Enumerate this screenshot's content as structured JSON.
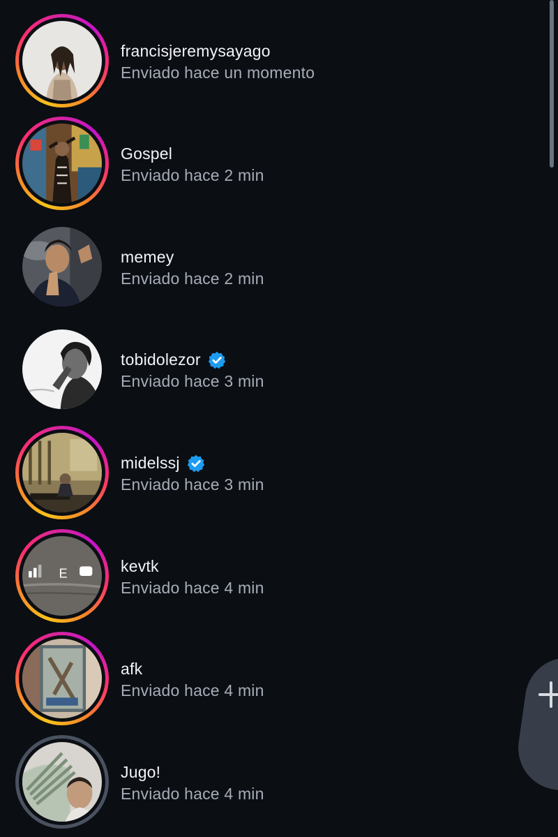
{
  "colors": {
    "background": "#0b0e13",
    "name_text": "#f2f4f7",
    "subtitle_text": "#a6adb8",
    "verified_badge": "#1d9bf0",
    "story_ring": "gradient",
    "seen_ring": "#4a5260"
  },
  "rows": [
    {
      "name": "francisjeremysayago",
      "status": "Enviado hace un momento",
      "verified": false,
      "ring": "story"
    },
    {
      "name": "Gospel",
      "status": "Enviado hace 2 min",
      "verified": false,
      "ring": "story"
    },
    {
      "name": "memey",
      "status": "Enviado hace 2 min",
      "verified": false,
      "ring": "none"
    },
    {
      "name": "tobidolezor",
      "status": "Enviado hace 3 min",
      "verified": true,
      "ring": "none"
    },
    {
      "name": "midelssj",
      "status": "Enviado hace 3 min",
      "verified": true,
      "ring": "story"
    },
    {
      "name": "kevtk",
      "status": "Enviado hace 4 min",
      "verified": false,
      "ring": "story"
    },
    {
      "name": "afk",
      "status": "Enviado hace 4 min",
      "verified": false,
      "ring": "story"
    },
    {
      "name": "Jugo!",
      "status": "Enviado hace 4 min",
      "verified": false,
      "ring": "seen"
    }
  ],
  "avatar_icons": [
    "profile-photo",
    "profile-photo",
    "profile-photo",
    "profile-photo",
    "profile-photo",
    "profile-photo",
    "profile-photo",
    "profile-photo"
  ],
  "kevtk_avatar": {
    "signal_label": "E"
  },
  "fab_icon": "plus-icon"
}
